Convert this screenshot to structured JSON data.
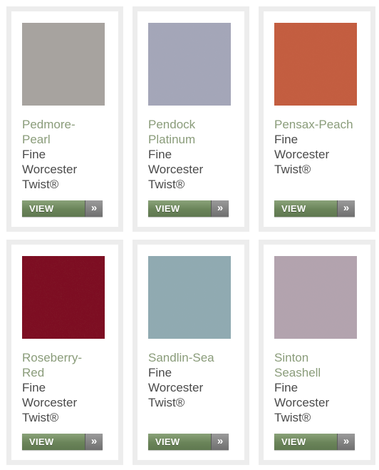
{
  "products": [
    {
      "name_line1": "Pedmore-",
      "name_line2": "Pearl",
      "desc_line1": "Fine",
      "desc_line2": "Worcester",
      "desc_line3": "Twist®",
      "swatch_color": "#a7a39f",
      "view_label": "VIEW",
      "arrow_icon": "»"
    },
    {
      "name_line1": "Pendock",
      "name_line2": "Platinum",
      "desc_line1": "Fine",
      "desc_line2": "Worcester",
      "desc_line3": "Twist®",
      "swatch_color": "#a4a6b8",
      "view_label": "VIEW",
      "arrow_icon": "»"
    },
    {
      "name_line1": "Pensax-Peach",
      "name_line2": "",
      "desc_line1": "Fine",
      "desc_line2": "Worcester",
      "desc_line3": "Twist®",
      "swatch_color": "#c35d3f",
      "view_label": "VIEW",
      "arrow_icon": "»"
    },
    {
      "name_line1": "Roseberry-",
      "name_line2": "Red",
      "desc_line1": "Fine",
      "desc_line2": "Worcester",
      "desc_line3": "Twist®",
      "swatch_color": "#7d0f22",
      "view_label": "VIEW",
      "arrow_icon": "»"
    },
    {
      "name_line1": "Sandlin-Sea",
      "name_line2": "",
      "desc_line1": "Fine",
      "desc_line2": "Worcester",
      "desc_line3": "Twist®",
      "swatch_color": "#90aab1",
      "view_label": "VIEW",
      "arrow_icon": "»"
    },
    {
      "name_line1": "Sinton",
      "name_line2": "Seashell",
      "desc_line1": "Fine",
      "desc_line2": "Worcester",
      "desc_line3": "Twist®",
      "swatch_color": "#b3a3ae",
      "view_label": "VIEW",
      "arrow_icon": "»"
    }
  ]
}
